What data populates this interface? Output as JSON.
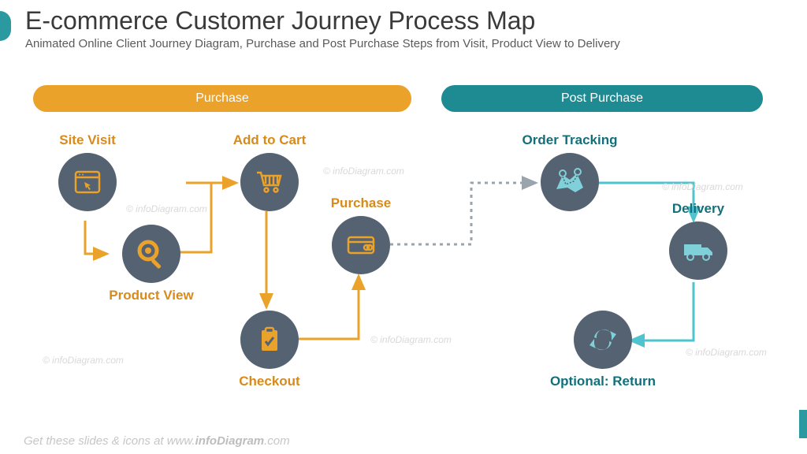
{
  "header": {
    "title": "E-commerce Customer Journey Process Map",
    "subtitle": "Animated Online Client Journey Diagram, Purchase and Post Purchase Steps from Visit, Product View to Delivery"
  },
  "sections": {
    "purchase": {
      "label": "Purchase"
    },
    "post_purchase": {
      "label": "Post Purchase"
    }
  },
  "nodes": {
    "site_visit": {
      "label": "Site Visit"
    },
    "product_view": {
      "label": "Product View"
    },
    "add_to_cart": {
      "label": "Add to Cart"
    },
    "checkout": {
      "label": "Checkout"
    },
    "purchase": {
      "label": "Purchase"
    },
    "order_tracking": {
      "label": "Order Tracking"
    },
    "delivery": {
      "label": "Delivery"
    },
    "return": {
      "label": "Optional: Return"
    }
  },
  "colors": {
    "orange": "#eaa22a",
    "orange_text": "#d88a1a",
    "teal": "#1e8a92",
    "teal_light": "#4fc4cf",
    "teal_text": "#12707a",
    "node_bg": "#546272"
  },
  "footer": {
    "prefix": "Get these slides & icons at www.",
    "brand": "infoDiagram",
    "suffix": ".com"
  },
  "watermark": "© infoDiagram.com"
}
